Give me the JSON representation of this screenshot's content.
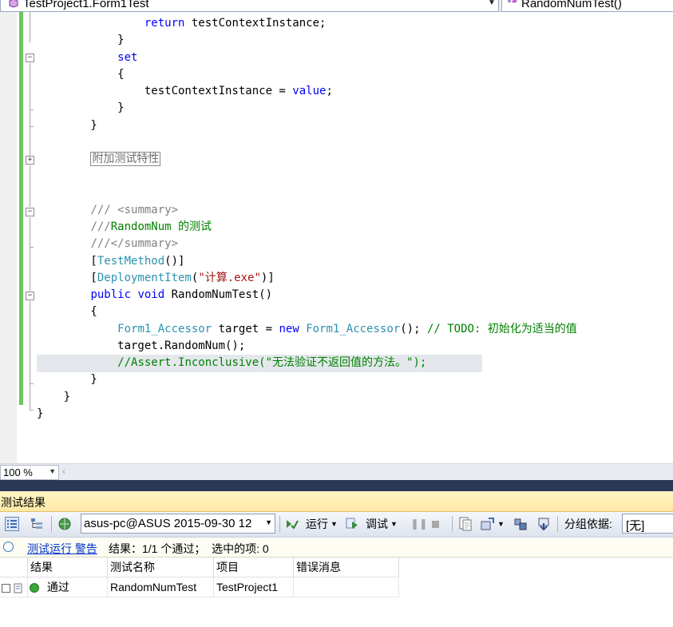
{
  "navbar": {
    "class_selector": "TestProject1.Form1Test",
    "member_selector": "RandomNumTest()"
  },
  "editor": {
    "lines": [
      [
        {
          "t": "                "
        },
        {
          "t": "return",
          "c": "kw"
        },
        {
          "t": " testContextInstance;"
        }
      ],
      [
        {
          "t": "            }"
        }
      ],
      [
        {
          "t": "            "
        },
        {
          "t": "set",
          "c": "kw"
        }
      ],
      [
        {
          "t": "            {"
        }
      ],
      [
        {
          "t": "                testContextInstance = "
        },
        {
          "t": "value",
          "c": "kw"
        },
        {
          "t": ";"
        }
      ],
      [
        {
          "t": "            }"
        }
      ],
      [
        {
          "t": "        }"
        }
      ],
      [
        {
          "t": ""
        }
      ],
      [
        {
          "t": "        "
        },
        {
          "t": "附加测试特性",
          "c": "region"
        }
      ],
      [
        {
          "t": ""
        }
      ],
      [
        {
          "t": ""
        }
      ],
      [
        {
          "t": "        "
        },
        {
          "t": "/// ",
          "c": "doc"
        },
        {
          "t": "<summary>",
          "c": "doc"
        }
      ],
      [
        {
          "t": "        "
        },
        {
          "t": "///",
          "c": "doc"
        },
        {
          "t": "RandomNum 的测试",
          "c": "cm"
        }
      ],
      [
        {
          "t": "        "
        },
        {
          "t": "///</summary>",
          "c": "doc"
        }
      ],
      [
        {
          "t": "        ["
        },
        {
          "t": "TestMethod",
          "c": "ty"
        },
        {
          "t": "()]"
        }
      ],
      [
        {
          "t": "        ["
        },
        {
          "t": "DeploymentItem",
          "c": "ty"
        },
        {
          "t": "("
        },
        {
          "t": "\"计算.exe\"",
          "c": "st"
        },
        {
          "t": ")]"
        }
      ],
      [
        {
          "t": "        "
        },
        {
          "t": "public",
          "c": "kw"
        },
        {
          "t": " "
        },
        {
          "t": "void",
          "c": "kw"
        },
        {
          "t": " RandomNumTest()"
        }
      ],
      [
        {
          "t": "        {"
        }
      ],
      [
        {
          "t": "            "
        },
        {
          "t": "Form1_Accessor",
          "c": "ty"
        },
        {
          "t": " target = "
        },
        {
          "t": "new",
          "c": "kw"
        },
        {
          "t": " "
        },
        {
          "t": "Form1_Accessor",
          "c": "ty"
        },
        {
          "t": "(); "
        },
        {
          "t": "// TODO: 初始化为适当的值",
          "c": "cm"
        }
      ],
      [
        {
          "t": "            target.RandomNum();"
        }
      ],
      [
        {
          "t": "            "
        },
        {
          "t": "//Assert.Inconclusive(\"无法验证不返回值的方法。\");",
          "c": "cm"
        }
      ],
      [
        {
          "t": "        }"
        }
      ],
      [
        {
          "t": "    }"
        }
      ],
      [
        {
          "t": "}"
        }
      ]
    ]
  },
  "zoom": {
    "level": "100 %"
  },
  "results_panel": {
    "title": "测试结果",
    "toolbar": {
      "run_selector": "asus-pc@ASUS 2015-09-30 12",
      "run_label": "运行",
      "debug_label": "调试",
      "group_by_label": "分组依据:",
      "group_by_value": "[无]"
    },
    "status": {
      "link": "测试运行 警告",
      "summary": "结果：1/1 个通过；  选中的项: 0"
    },
    "grid": {
      "columns": [
        "结果",
        "测试名称",
        "项目",
        "错误消息"
      ],
      "rows": [
        {
          "result": "通过",
          "test_name": "RandomNumTest",
          "project": "TestProject1",
          "error": ""
        }
      ]
    }
  }
}
